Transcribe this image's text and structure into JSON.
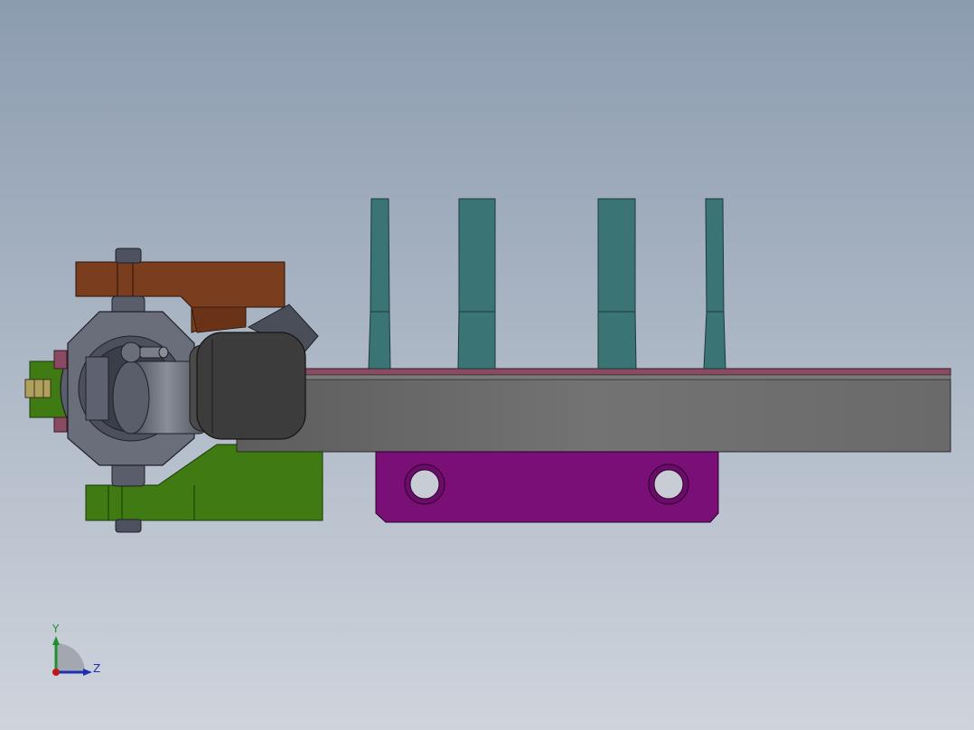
{
  "viewport": {
    "background_top": "#8c9cb0",
    "background_bottom": "#cfd4dc"
  },
  "colors": {
    "rail": "#6e6e6e",
    "rail_top_strip": "#8a4a62",
    "fin": "#3a7474",
    "base_plate": "#7a0f78",
    "upper_bracket": "#7a3e1e",
    "lower_bracket": "#3f7a12",
    "hub": "#5a5e6a",
    "motor": "#3c3c3c",
    "bolt": "#b0a060"
  },
  "triad": {
    "y_label": "Y",
    "z_label": "Z",
    "y_color": "#1f8f2f",
    "z_color": "#1f2fb0",
    "x_color": "#c01818"
  }
}
